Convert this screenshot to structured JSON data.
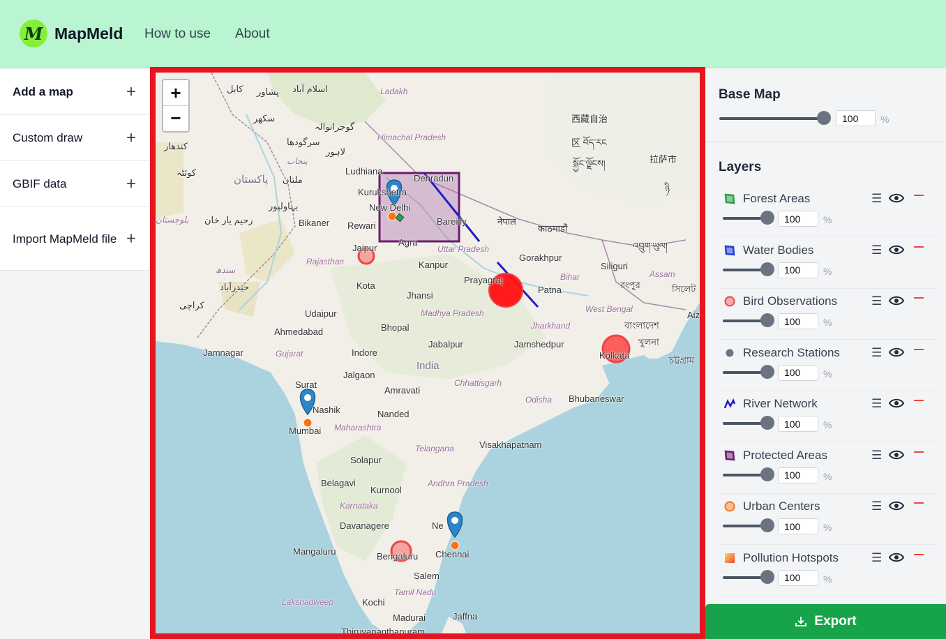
{
  "header": {
    "logo_letter": "M",
    "brand": "MapMeld",
    "nav": [
      "How to use",
      "About"
    ]
  },
  "sidebar": {
    "items": [
      {
        "label": "Add a map",
        "icon": "plus-icon"
      },
      {
        "label": "Custom draw",
        "icon": "plus-icon"
      },
      {
        "label": "GBIF data",
        "icon": "plus-icon"
      },
      {
        "label": "Import MapMeld file",
        "icon": "plus-icon"
      }
    ]
  },
  "map": {
    "zoom_in": "+",
    "zoom_out": "−",
    "labels": {
      "ladakh": "Ladakh",
      "himachal": "Himachal Pradesh",
      "ludhiana": "Ludhiana",
      "dehradun": "Dehradun",
      "kurukshetra": "Kurukshetra",
      "newdelhi": "New Delhi",
      "rewari": "Rewari",
      "bareilly": "Bareilly",
      "agra": "Agra",
      "uttar": "Uttar Pradesh",
      "bikaner": "Bikaner",
      "jaipur": "Jaipur",
      "rajasthan": "Rajasthan",
      "kota": "Kota",
      "kanpur": "Kanpur",
      "jhansi": "Jhansi",
      "gorakhpur": "Gorakhpur",
      "prayagraj": "Prayagraj",
      "patna": "Patna",
      "bihar": "Bihar",
      "siliguri": "Siliguri",
      "assam": "Assam",
      "westbengal": "West Bengal",
      "jharkhand": "Jharkhand",
      "udaipur": "Udaipur",
      "ahmedabad": "Ahmedabad",
      "madhya": "Madhya Pradesh",
      "bhopal": "Bhopal",
      "jabalpur": "Jabalpur",
      "jamshedpur": "Jamshedpur",
      "kolkata": "Kolkata",
      "jamnagar": "Jamnagar",
      "gujarat": "Gujarat",
      "indore": "Indore",
      "india": "India",
      "surat": "Surat",
      "jalgaon": "Jalgaon",
      "chhattisgarh": "Chhattisgarh",
      "amravati": "Amravati",
      "odisha": "Odisha",
      "bhubaneswar": "Bhubaneswar",
      "nashik": "Nashik",
      "nanded": "Nanded",
      "mumbai": "Mumbai",
      "maharashtra": "Maharashtra",
      "telangana": "Telangana",
      "visakhapatnam": "Visakhapatnam",
      "solapur": "Solapur",
      "belagavi": "Belagavi",
      "andhra": "Andhra Pradesh",
      "kurnool": "Kurnool",
      "karnataka": "Karnataka",
      "davanagere": "Davanagere",
      "nellore": "Ne",
      "mangaluru": "Mangaluru",
      "bengaluru": "Bengaluru",
      "chennai": "Chennai",
      "salem": "Salem",
      "tamilnadu": "Tamil Nadu",
      "lakshadweep": "Lakshadweep",
      "kochi": "Kochi",
      "madurai": "Madurai",
      "jaffna": "Jaffna",
      "thiru": "Thiruvananthapuram",
      "kabul": "کابل",
      "peshawar": "پشاور",
      "islamabad": "اسلام آباد",
      "gujranwala": "گوجرانوالہ",
      "kandahar": "کندهار",
      "sargodha": "سرگودھا",
      "lahore": "لاہور",
      "punjab": "پنجاب",
      "quetta": "کوئٹہ",
      "pakistan": "پاکستان",
      "multan": "ملتان",
      "bahawalpur": "بہاولپور",
      "balochistan": "بلوچستان",
      "rahimyar": "رحیم یار خان",
      "sukkur": "سکھر",
      "sindh": "سندھ",
      "hyderabad": "حیدرآباد",
      "karachi": "کراچی",
      "nepal": "नेपाल",
      "kathmandu": "काठमाडौं",
      "bhutan": "འབྲུག་ཡུལ།",
      "tibet": "西藏自治",
      "tibet2": "区 བོད་རང",
      "tibet3": "སྐྱོང་ལྗོངས།",
      "lhasa": "拉萨市",
      "bangladesh": "বাংলাদেশ",
      "khulna": "খুলনা",
      "rangpur": "রংপুর",
      "sylhet": "সিলেট",
      "chittagong": "চট্টগ্রাম",
      "aiz": "Aiz",
      "ni": "ཉི"
    }
  },
  "basemap": {
    "title": "Base Map",
    "opacity": "100",
    "unit": "%"
  },
  "layers": {
    "title": "Layers",
    "unit": "%",
    "items": [
      {
        "name": "Forest Areas",
        "opacity": "100",
        "color": "#2f9e44",
        "kind": "polygon"
      },
      {
        "name": "Water Bodies",
        "opacity": "100",
        "color": "#1e3fd8",
        "kind": "polygon"
      },
      {
        "name": "Bird Observations",
        "opacity": "100",
        "color": "#ef4444",
        "kind": "circle"
      },
      {
        "name": "Research Stations",
        "opacity": "100",
        "color": "#6b7280",
        "kind": "dot"
      },
      {
        "name": "River Network",
        "opacity": "100",
        "color": "#1e1ec8",
        "kind": "line"
      },
      {
        "name": "Protected Areas",
        "opacity": "100",
        "color": "#6b1b6b",
        "kind": "polygon"
      },
      {
        "name": "Urban Centers",
        "opacity": "100",
        "color": "#f97316",
        "kind": "circle"
      },
      {
        "name": "Pollution Hotspots",
        "opacity": "100",
        "color": "#f97316",
        "kind": "gradient"
      }
    ]
  },
  "export_label": "Export"
}
